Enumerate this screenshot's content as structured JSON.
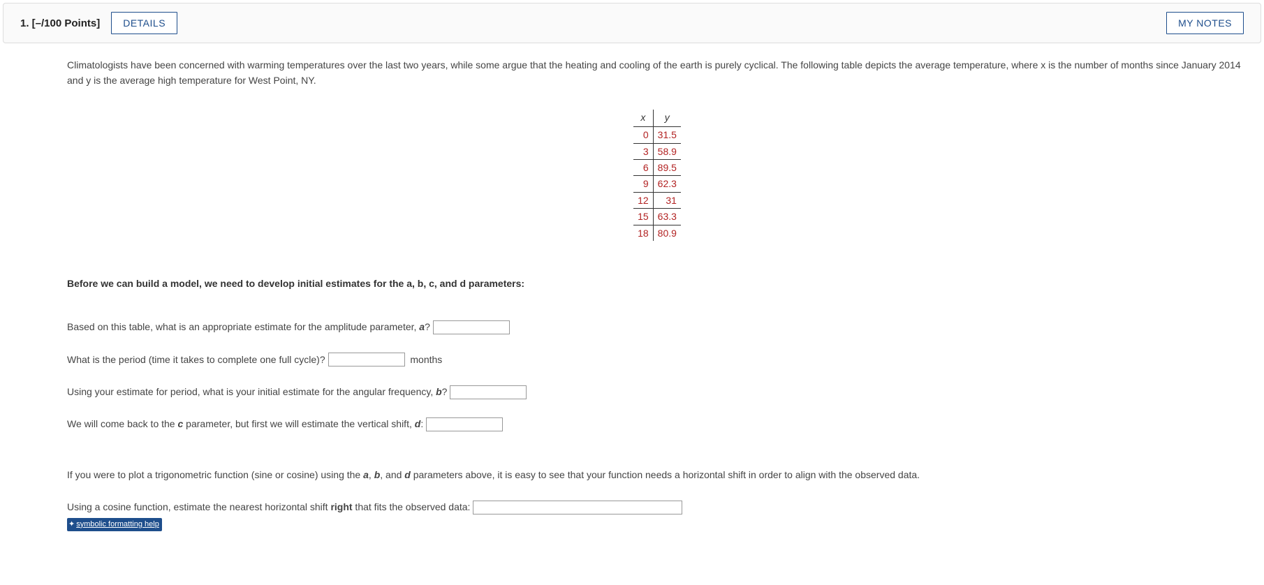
{
  "header": {
    "question_label": "1. [–/100 Points]",
    "details_label": "DETAILS",
    "notes_label": "MY NOTES"
  },
  "intro": "Climatologists have been concerned with warming temperatures over the last two years, while some argue that the heating and cooling of the earth is purely cyclical. The following table depicts the average temperature, where x is the number of months since January 2014 and y is the average high temperature for West Point, NY.",
  "chart_data": {
    "type": "table",
    "columns": [
      "x",
      "y"
    ],
    "rows": [
      {
        "x": "0",
        "y": "31.5"
      },
      {
        "x": "3",
        "y": "58.9"
      },
      {
        "x": "6",
        "y": "89.5"
      },
      {
        "x": "9",
        "y": "62.3"
      },
      {
        "x": "12",
        "y": "31"
      },
      {
        "x": "15",
        "y": "63.3"
      },
      {
        "x": "18",
        "y": "80.9"
      }
    ]
  },
  "instruction": "Before we can build a model, we need to develop initial estimates for the a, b, c, and d parameters:",
  "questions": {
    "q1_pre": "Based on this table, what is an appropriate estimate for the amplitude parameter, ",
    "q1_param": "a",
    "q1_post": "?",
    "q2_text": "What is the period (time it takes to complete one full cycle)?",
    "q2_units": "months",
    "q3_pre": "Using your estimate for period, what is your initial estimate for the angular frequency, ",
    "q3_param": "b",
    "q3_post": "?",
    "q4_pre": "We will come back to the ",
    "q4_param1": "c",
    "q4_mid": " parameter, but first we will estimate the vertical shift, ",
    "q4_param2": "d",
    "q4_post": ":"
  },
  "plot_text_pre": "If you were to plot a trigonometric function (sine or cosine) using the ",
  "plot_a": "a",
  "plot_sep1": ", ",
  "plot_b": "b",
  "plot_sep2": ", and ",
  "plot_d": "d",
  "plot_text_post": " parameters above, it is easy to see that your function needs a horizontal shift in order to align with the observed data.",
  "shift_question_pre": "Using a cosine function, estimate the nearest horizontal shift ",
  "shift_bold": "right",
  "shift_question_post": " that fits the observed data:",
  "help_label": "symbolic formatting help"
}
